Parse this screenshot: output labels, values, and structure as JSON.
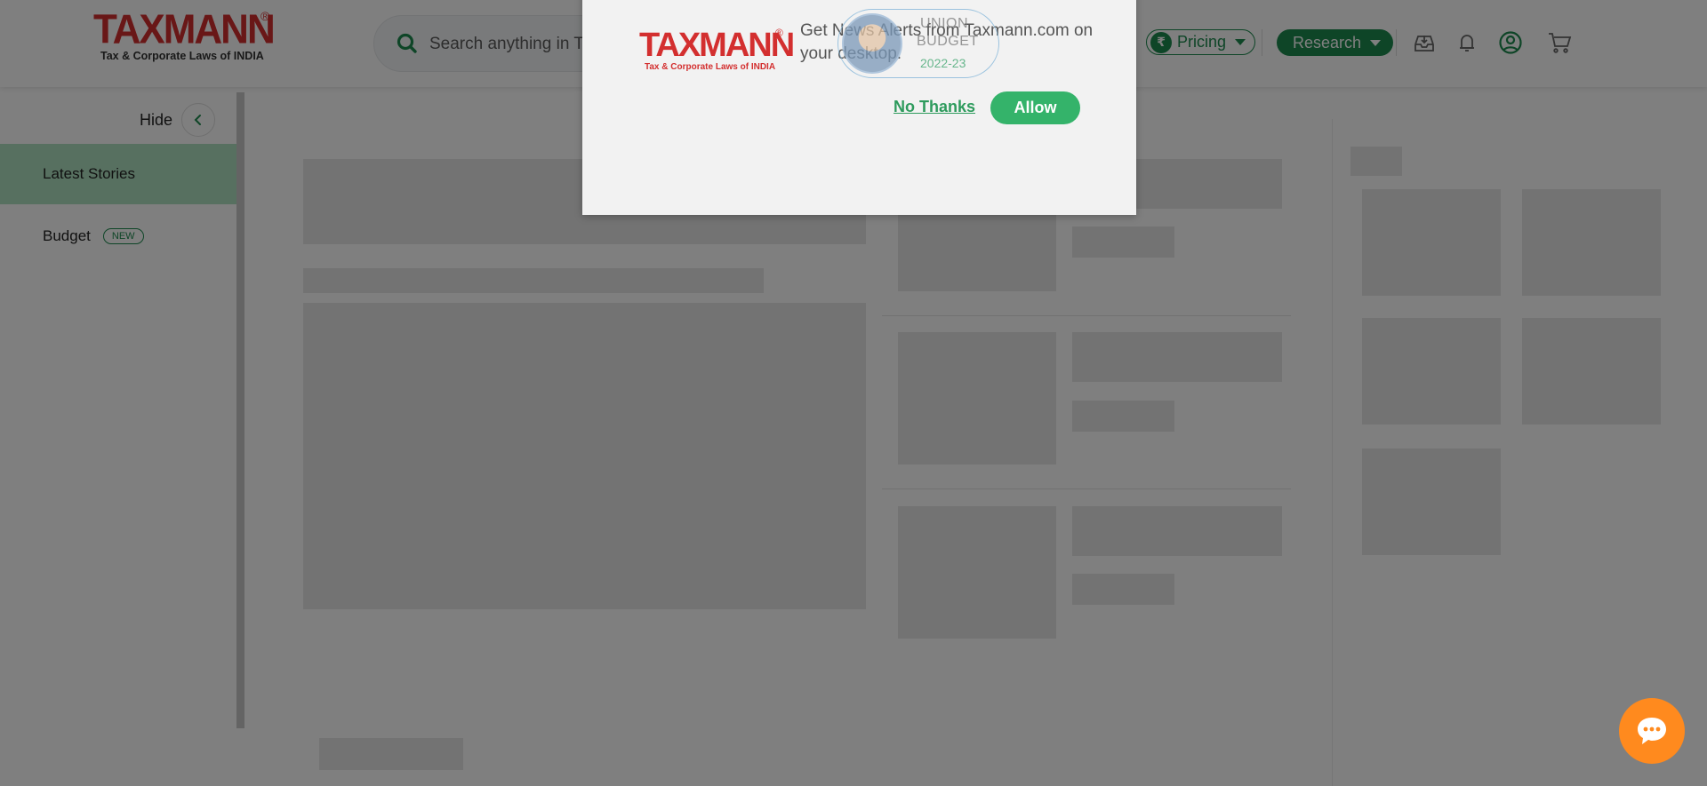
{
  "header": {
    "logo": {
      "name": "TAXMANN",
      "registered": "®",
      "tagline": "Tax & Corporate Laws of INDIA"
    },
    "search": {
      "placeholder": "Search anything in Taxmann Research"
    },
    "pricing": {
      "label": "Pricing",
      "currency_symbol": "₹"
    },
    "research": {
      "label": "Research"
    },
    "icons": [
      "download-icon",
      "bell-icon",
      "user-icon",
      "cart-icon"
    ]
  },
  "sidebar": {
    "hide_label": "Hide",
    "items": [
      {
        "label": "Latest Stories",
        "active": true
      },
      {
        "label": "Budget",
        "badge": "NEW",
        "active": false
      }
    ]
  },
  "popup": {
    "logo": {
      "name": "TAXMANN",
      "registered": "®",
      "tagline": "Tax & Corporate Laws of INDIA"
    },
    "message": "Get News Alerts from Taxmann.com on your desktop.",
    "no_thanks_label": "No Thanks",
    "allow_label": "Allow"
  },
  "budget_pill": {
    "line1": "UNION",
    "line2": "BUDGET",
    "year": "2022-23"
  },
  "colors": {
    "brand_red": "#d32f2f",
    "brand_green": "#1d8a4e",
    "active_sidebar": "#aee0c1",
    "chat_orange": "#ff8a1e",
    "overlay": "rgba(0,0,0,0.5)"
  }
}
